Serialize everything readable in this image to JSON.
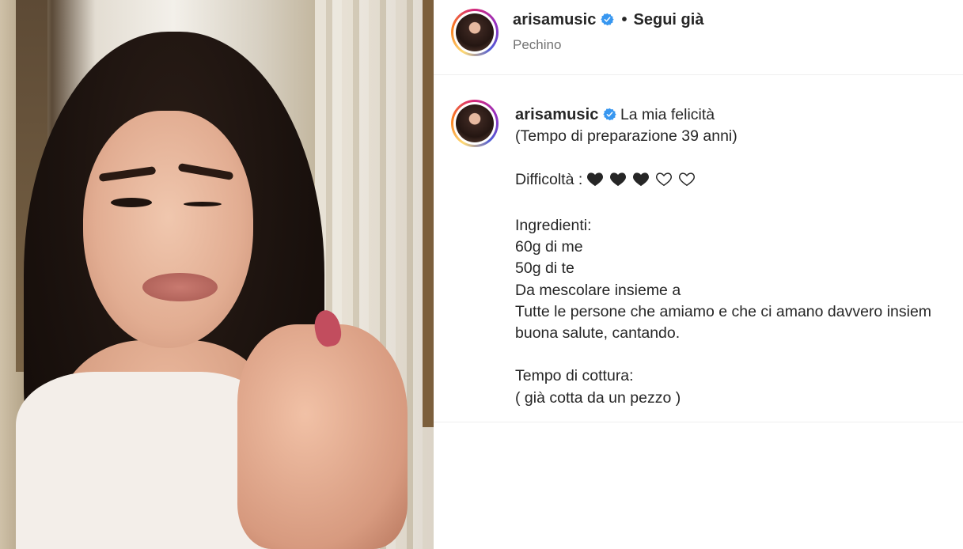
{
  "post": {
    "username": "arisamusic",
    "follow_status": "Segui già",
    "separator": "•",
    "location": "Pechino"
  },
  "caption": {
    "username": "arisamusic",
    "lines": [
      "La mia felicità",
      "(Tempo di preparazione 39 anni)",
      "",
      "Difficoltà :",
      "",
      "Ingredienti:",
      "60g di me",
      "50g di te",
      "Da mescolare insieme a",
      "Tutte le persone che amiamo e che ci amano davvero insiem",
      "buona salute, cantando.",
      "",
      "Tempo di cottura:",
      "( già cotta da un pezzo )"
    ],
    "difficulty": {
      "filled": 3,
      "total": 5,
      "filled_color": "#262626"
    }
  },
  "colors": {
    "verified_badge": "#3897f0",
    "secondary_text": "#737373",
    "primary_text": "#262626"
  },
  "icons": {
    "verified": "verified-badge-icon",
    "heart_filled": "black-heart-icon",
    "heart_empty": "white-heart-icon"
  }
}
